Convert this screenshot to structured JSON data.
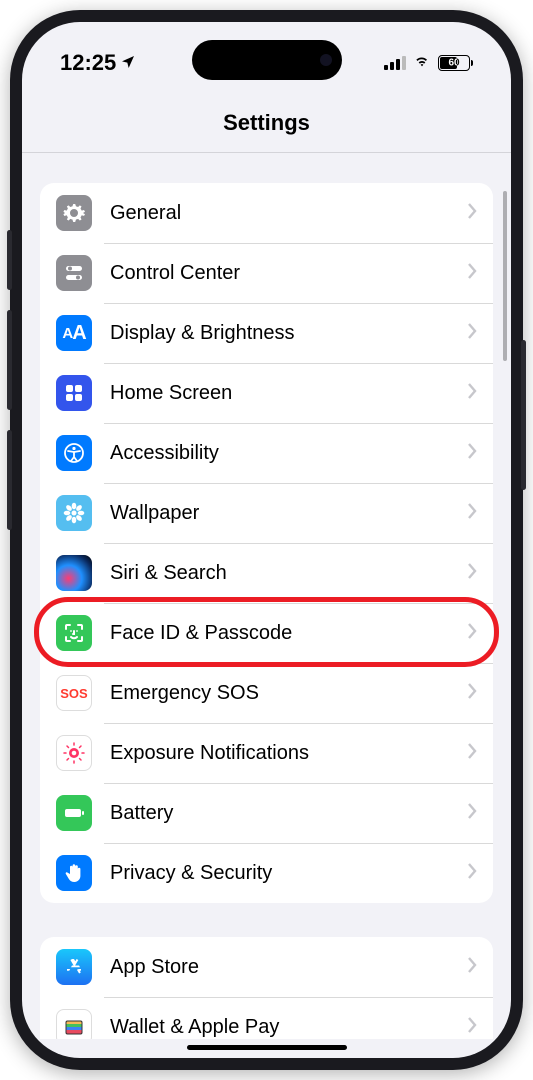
{
  "status": {
    "time": "12:25",
    "location_active": true,
    "battery_pct": "60"
  },
  "header": {
    "title": "Settings"
  },
  "groups": [
    {
      "rows": [
        {
          "id": "general",
          "label": "General",
          "icon": "gear-icon",
          "bg": "gray"
        },
        {
          "id": "control-center",
          "label": "Control Center",
          "icon": "switches-icon",
          "bg": "gray"
        },
        {
          "id": "display",
          "label": "Display & Brightness",
          "icon": "text-size-icon",
          "bg": "blue"
        },
        {
          "id": "home-screen",
          "label": "Home Screen",
          "icon": "grid-icon",
          "bg": "indigo"
        },
        {
          "id": "accessibility",
          "label": "Accessibility",
          "icon": "accessibility-icon",
          "bg": "blue"
        },
        {
          "id": "wallpaper",
          "label": "Wallpaper",
          "icon": "flower-icon",
          "bg": "teal"
        },
        {
          "id": "siri",
          "label": "Siri & Search",
          "icon": "siri-icon",
          "bg": "siri"
        },
        {
          "id": "faceid",
          "label": "Face ID & Passcode",
          "icon": "faceid-icon",
          "bg": "green",
          "highlighted": true
        },
        {
          "id": "sos",
          "label": "Emergency SOS",
          "icon": "sos-icon",
          "bg": "white"
        },
        {
          "id": "exposure",
          "label": "Exposure Notifications",
          "icon": "exposure-icon",
          "bg": "white"
        },
        {
          "id": "battery",
          "label": "Battery",
          "icon": "battery-icon",
          "bg": "green"
        },
        {
          "id": "privacy",
          "label": "Privacy & Security",
          "icon": "hand-icon",
          "bg": "blue"
        }
      ]
    },
    {
      "rows": [
        {
          "id": "appstore",
          "label": "App Store",
          "icon": "appstore-icon",
          "bg": "white"
        },
        {
          "id": "wallet",
          "label": "Wallet & Apple Pay",
          "icon": "wallet-icon",
          "bg": "white"
        }
      ]
    }
  ],
  "annotation": {
    "highlighted_row": "faceid",
    "color": "#ec1c24"
  },
  "sos_text": "SOS"
}
